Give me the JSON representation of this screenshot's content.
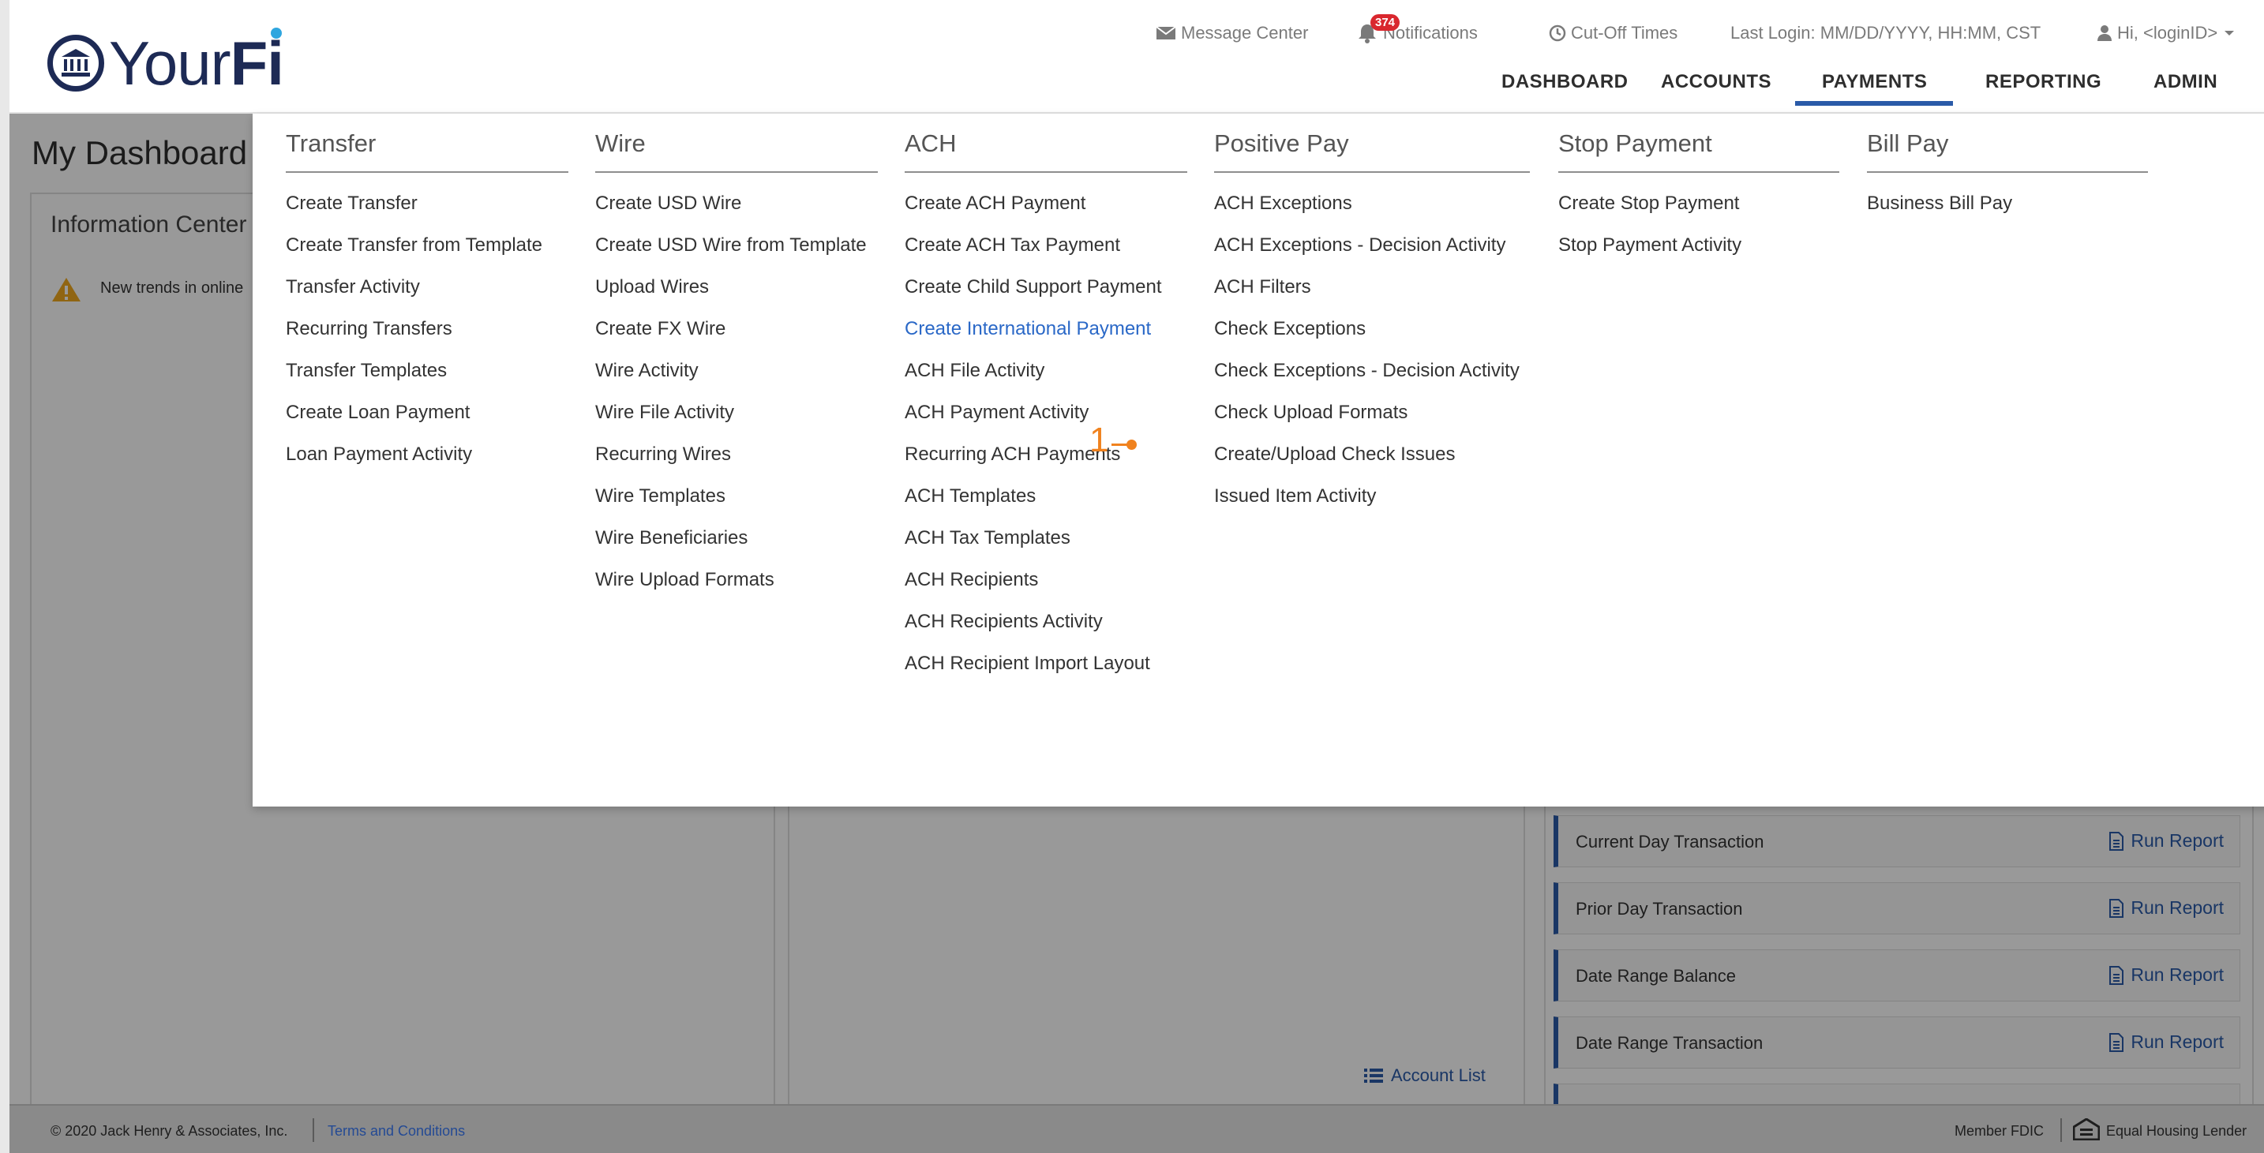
{
  "header": {
    "logo_text_regular": "Your",
    "logo_text_bold": "Fi",
    "utility": {
      "message_center": "Message Center",
      "notifications_count": "374",
      "notifications": "Notifications",
      "cutoff_times": "Cut-Off Times",
      "last_login": "Last Login:  MM/DD/YYYY, HH:MM, CST",
      "user": "Hi, <loginID>"
    },
    "nav": {
      "dashboard": "DASHBOARD",
      "accounts": "ACCOUNTS",
      "payments": "PAYMENTS",
      "reporting": "REPORTING",
      "admin": "ADMIN"
    }
  },
  "dashboard": {
    "title": "My Dashboard",
    "info_center_title": "Information Center",
    "info_line": "New trends in online",
    "reports": [
      {
        "label": "Current Day Transaction",
        "link": "Run Report"
      },
      {
        "label": "Prior Day Transaction",
        "link": "Run Report"
      },
      {
        "label": "Date Range Balance",
        "link": "Run Report"
      },
      {
        "label": "Date Range Transaction",
        "link": "Run Report"
      }
    ],
    "account_list": "Account List"
  },
  "menu": {
    "columns": [
      {
        "title": "Transfer",
        "items": [
          "Create Transfer",
          "Create Transfer from Template",
          "Transfer Activity",
          "Recurring Transfers",
          "Transfer Templates",
          "Create Loan Payment",
          "Loan Payment Activity"
        ]
      },
      {
        "title": "Wire",
        "items": [
          "Create USD Wire",
          "Create USD Wire from Template",
          "Upload Wires",
          "Create FX Wire",
          "Wire Activity",
          "Wire File Activity",
          "Recurring Wires",
          "Wire Templates",
          "Wire Beneficiaries",
          "Wire Upload Formats"
        ]
      },
      {
        "title": "ACH",
        "items": [
          "Create ACH Payment",
          "Create ACH Tax Payment",
          "Create Child Support Payment",
          "Create International Payment",
          "ACH File Activity",
          "ACH Payment Activity",
          "Recurring ACH Payments",
          "ACH Templates",
          "ACH Tax Templates",
          "ACH Recipients",
          "ACH Recipients Activity",
          "ACH Recipient Import Layout"
        ]
      },
      {
        "title": "Positive Pay",
        "items": [
          "ACH Exceptions",
          "ACH Exceptions - Decision Activity",
          "ACH Filters",
          "Check Exceptions",
          "Check Exceptions - Decision Activity",
          "Check Upload Formats",
          "Create/Upload Check Issues",
          "Issued Item Activity"
        ]
      },
      {
        "title": "Stop Payment",
        "items": [
          "Create Stop Payment",
          "Stop Payment Activity"
        ]
      },
      {
        "title": "Bill Pay",
        "items": [
          "Business Bill Pay"
        ]
      }
    ],
    "callout_number": "1"
  },
  "footer": {
    "copyright": "© 2020 Jack Henry & Associates, Inc.",
    "terms": "Terms and Conditions",
    "member_fdic": "Member FDIC",
    "equal_housing": "Equal Housing Lender"
  },
  "colors": {
    "brand_navy": "#1d2a55",
    "accent_blue": "#2a5aa8",
    "link_active": "#2a68c7",
    "callout_orange": "#f0821e",
    "badge_red": "#d9272e"
  }
}
